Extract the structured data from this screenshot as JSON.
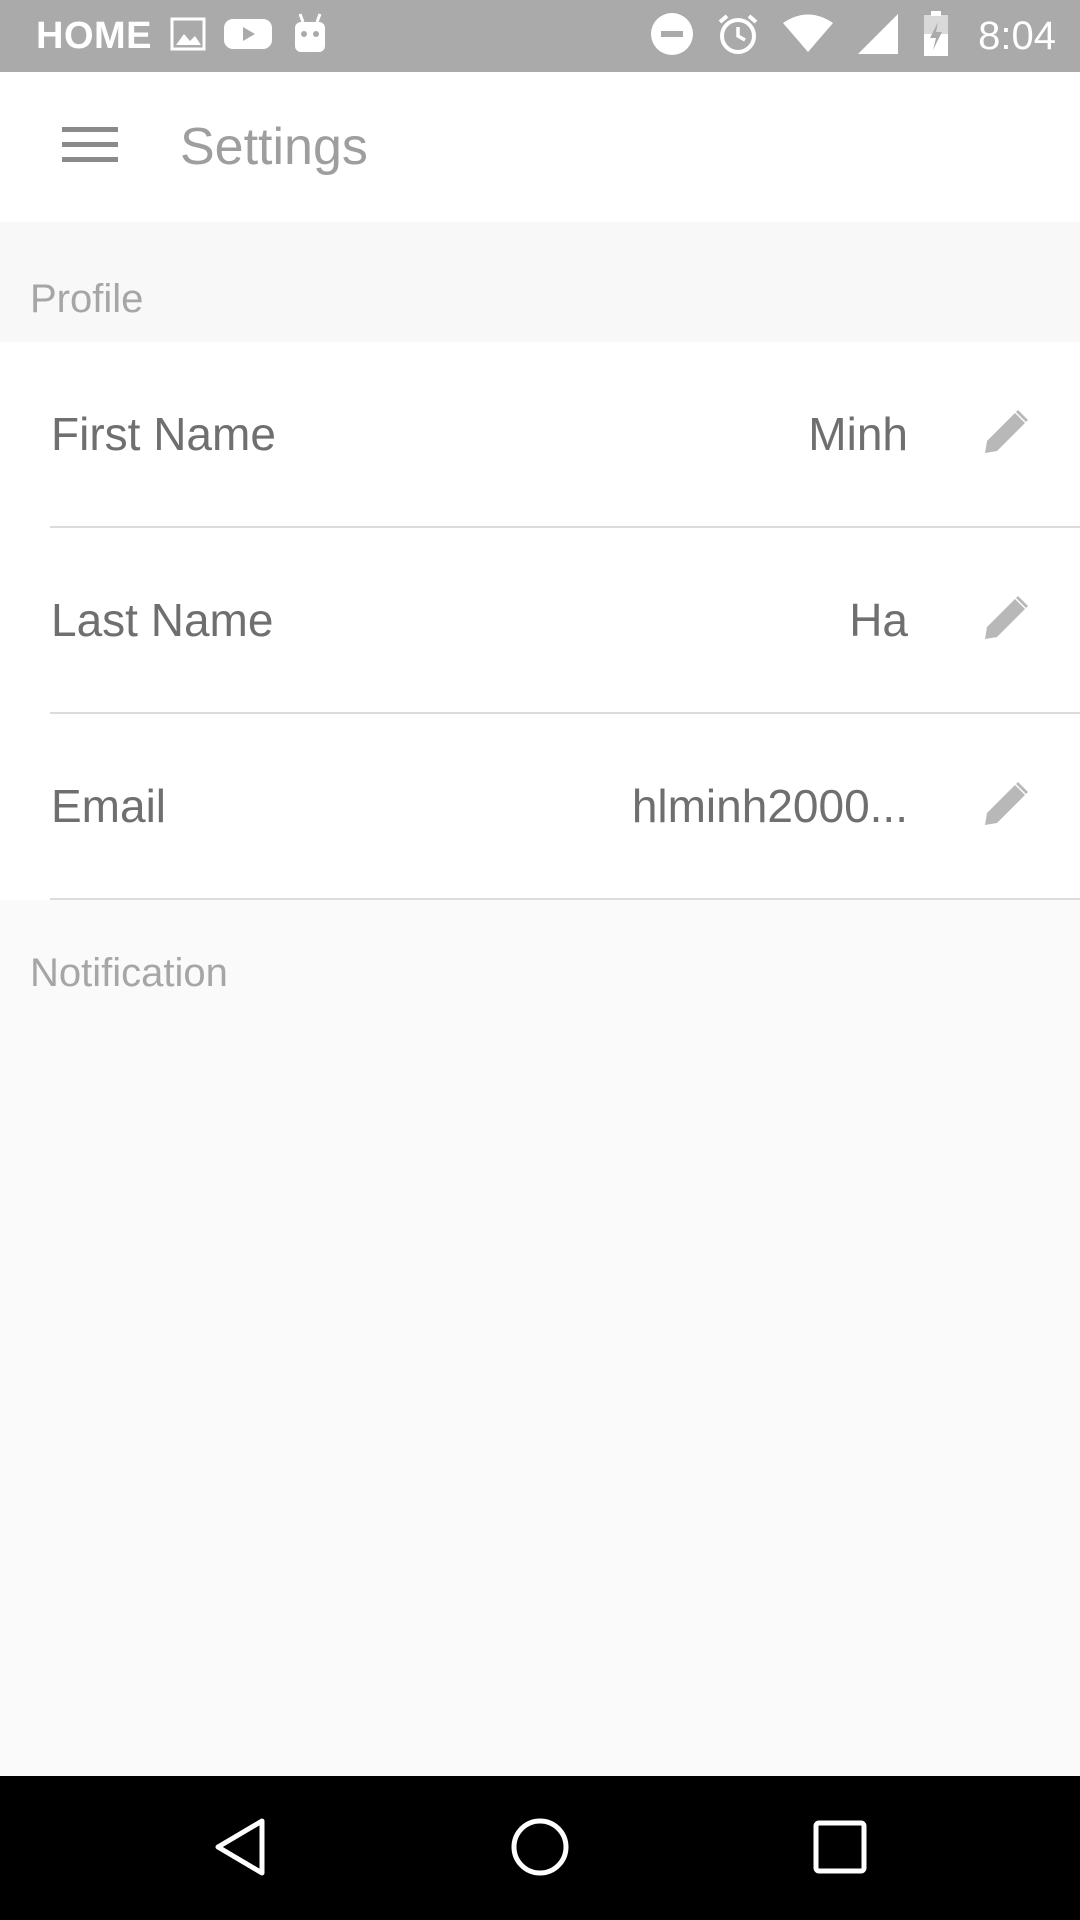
{
  "status_bar": {
    "carrier": "HOME",
    "time": "8:04",
    "icons": [
      "image-icon",
      "youtube-icon",
      "android-icon",
      "do-not-disturb-icon",
      "alarm-icon",
      "wifi-icon",
      "signal-icon",
      "battery-charging-icon"
    ]
  },
  "app_bar": {
    "title": "Settings",
    "menu_icon": "hamburger-menu-icon"
  },
  "sections": {
    "profile": "Profile",
    "notification": "Notification"
  },
  "profile": {
    "rows": [
      {
        "label": "First Name",
        "value": "Minh"
      },
      {
        "label": "Last Name",
        "value": "Ha"
      },
      {
        "label": "Email",
        "value": "hlminh2000..."
      }
    ],
    "edit_icon": "pencil-icon"
  },
  "nav_bar": {
    "icons": [
      "back-icon",
      "home-icon",
      "recents-icon"
    ]
  },
  "colors": {
    "status_bar": "#aaaaaa",
    "app_bar": "#ffffff",
    "background": "#fafafa",
    "text_primary": "#6f6f6f",
    "text_secondary": "#a6a6a6",
    "nav_bar": "#000000"
  }
}
